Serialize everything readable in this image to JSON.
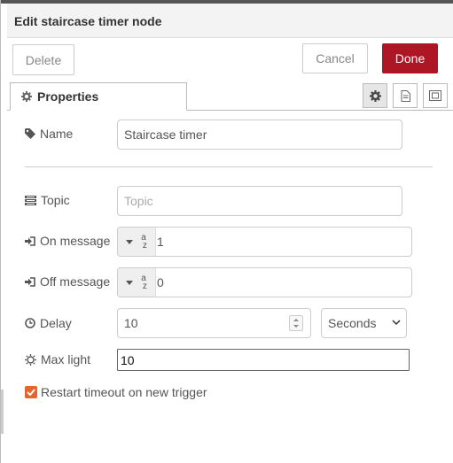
{
  "header": {
    "title": "Edit staircase timer node"
  },
  "buttons": {
    "delete": "Delete",
    "cancel": "Cancel",
    "done": "Done"
  },
  "tabs": [
    {
      "label": "Properties",
      "icon": "gear-icon"
    }
  ],
  "tab_icons": [
    "gear-icon",
    "document-icon",
    "frame-icon"
  ],
  "fields": {
    "name": {
      "label": "Name",
      "value": "Staircase timer",
      "icon": "tag-icon"
    },
    "topic": {
      "label": "Topic",
      "value": "",
      "placeholder": "Topic",
      "icon": "list-icon"
    },
    "on_message": {
      "label": "On message",
      "type": "az",
      "value": "1",
      "icon": "sign-in-icon"
    },
    "off_message": {
      "label": "Off message",
      "type": "az",
      "value": "0",
      "icon": "sign-in-icon"
    },
    "delay": {
      "label": "Delay",
      "value": "10",
      "unit": "Seconds",
      "icon": "clock-icon"
    },
    "max_light": {
      "label": "Max light",
      "value": "10",
      "icon": "sun-icon"
    },
    "restart": {
      "label": "Restart timeout on new trigger",
      "checked": true
    }
  },
  "colors": {
    "accent": "#ad1625",
    "checkbox": "#e8652a"
  }
}
